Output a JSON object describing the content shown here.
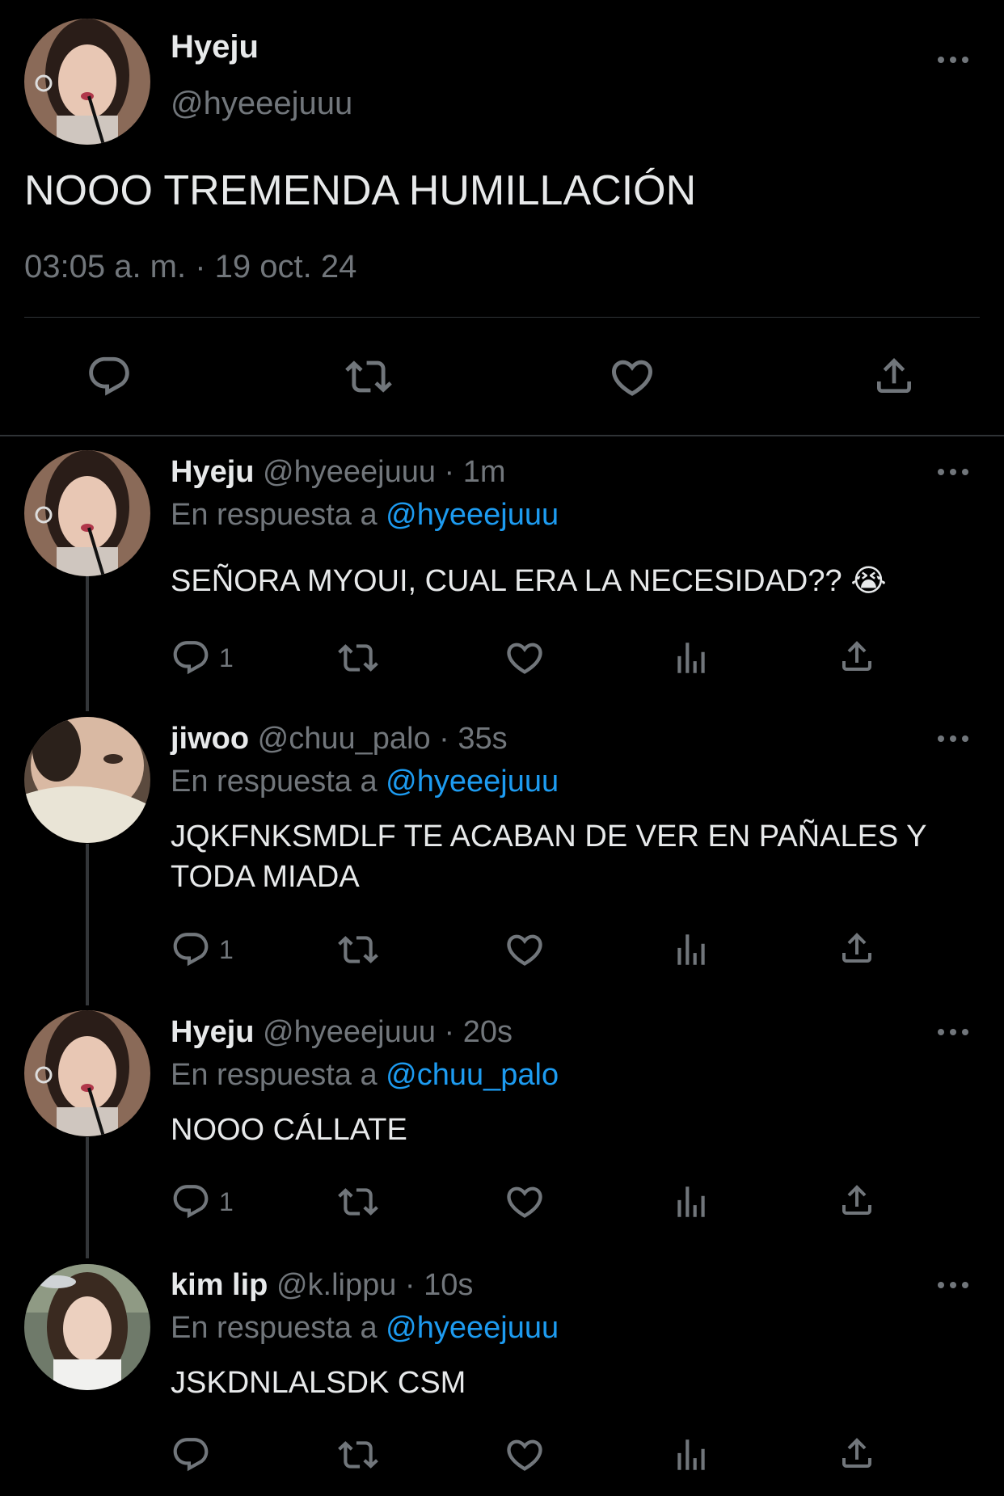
{
  "main_tweet": {
    "display_name": "Hyeju",
    "handle": "@hyeeejuuu",
    "text": "NOOO TREMENDA HUMILLACIÓN",
    "timestamp": "03:05 a. m. · 19 oct. 24"
  },
  "replies": [
    {
      "display_name": "Hyeju",
      "meta": "@hyeeejuuu · 1m",
      "reply_prefix": "En respuesta a",
      "reply_to": "@hyeeejuuu",
      "text": "SEÑORA MYOUI, CUAL ERA LA NECESIDAD?? 😭",
      "reply_count": "1"
    },
    {
      "display_name": "jiwoo",
      "meta": "@chuu_palo · 35s",
      "reply_prefix": "En respuesta a",
      "reply_to": "@hyeeejuuu",
      "text": "JQKFNKSMDLF TE ACABAN DE VER EN PAÑALES Y TODA MIADA",
      "reply_count": "1"
    },
    {
      "display_name": "Hyeju",
      "meta": "@hyeeejuuu · 20s",
      "reply_prefix": "En respuesta a",
      "reply_to": "@chuu_palo",
      "text": "NOOO CÁLLATE",
      "reply_count": "1"
    },
    {
      "display_name": "kim lip",
      "meta": "@k.lippu · 10s",
      "reply_prefix": "En respuesta a",
      "reply_to": "@hyeeejuuu",
      "text": "JSKDNLALSDK CSM",
      "reply_count": ""
    }
  ],
  "icons": {
    "reply": "reply-icon",
    "retweet": "retweet-icon",
    "like": "heart-icon",
    "views": "views-icon",
    "share": "share-icon",
    "more": "more-icon"
  },
  "colors": {
    "background": "#000000",
    "text": "#e7e9ea",
    "muted": "#71767b",
    "link": "#1d9bf0"
  }
}
